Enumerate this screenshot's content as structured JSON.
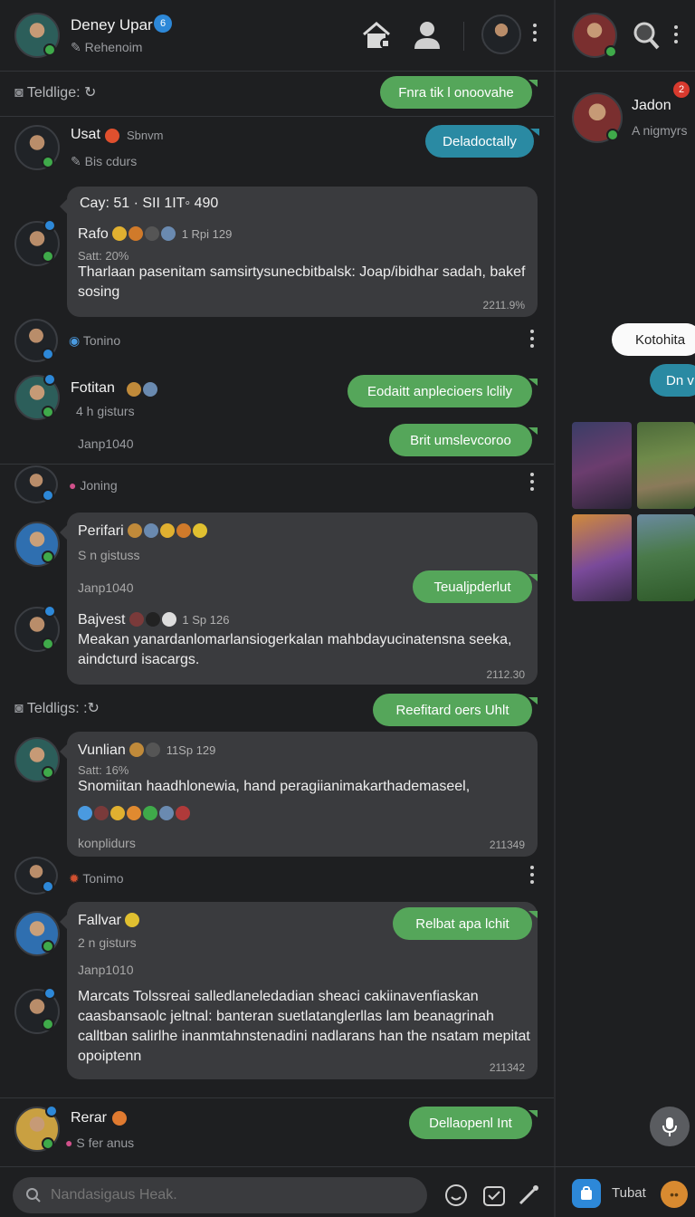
{
  "header": {
    "user_name": "Deney Upar",
    "user_sub": "Rehenoim",
    "badge_count": "6"
  },
  "right_panel": {
    "contact_name": "Jadon",
    "contact_sub": "A nigmyrs",
    "contact_badge": "2",
    "bubble_white": "Kotohita",
    "bubble_teal": "Dn v",
    "bottom_label": "Tubat"
  },
  "rows": {
    "section1_label": "Teldlige:",
    "section1_pill": "Fnra tik l onoovahe",
    "usat_name": "Usat",
    "usat_extra": "Sbnvm",
    "usat_sub": "Bis cdurs",
    "usat_pill": "Deladoctally",
    "card1_header": "Cay:  51 · SII 1IT◦ 490",
    "card1_name": "Rafo",
    "card1_meta": "1 Rpi 129",
    "card1_sub": "Satt: 20%",
    "card1_text": "Tharlaan pasenitam samsirtysunecbitbalsk: Joap/ibidhar sadah, bakef sosing",
    "card1_time": "2211.9%",
    "tonino1": "Tonino",
    "fotitan_name": "Fotitan",
    "fotitan_sub": "4 h gisturs",
    "fotitan_pill": "Eodaitt anplecioers lclily",
    "fotitan_date": "Janp1040",
    "fotitan_pill2": "Brit umslevcoroo",
    "joning": "Joning",
    "card2_name": "Perifari",
    "card2_sub": "S n gistuss",
    "card2_date": "Janp1040",
    "card2_pill": "Teualjpderlut",
    "card2_name2": "Bajvest",
    "card2_meta": "1 Sp 126",
    "card2_text": "Meakan yanardanlomarlansiogerkalan mahbdayucinatensna seeka, aindcturd isacargs.",
    "card2_time": "2112.30",
    "section2_label": "Teldligs:",
    "section2_pill": "Reefitard oers Uhlt",
    "card3_name": "Vunlian",
    "card3_meta": "11Sp 129",
    "card3_sub": "Satt: 16%",
    "card3_text": "Snomiitan haadhlonewia, hand peragiianimakarthademaseel,",
    "card3_foot": "konplidurs",
    "card3_time": "211349",
    "tonino2": "Tonimo",
    "card4_name": "Fallvar",
    "card4_sub": "2 n gisturs",
    "card4_pill": "Relbat  apa lchit",
    "card4_date": "Janp1010",
    "card4_text": "Marcats  Tolssreai salledlaneledadian sheaci cakiinavenfiaskan caasbansaolc jeltnal: banteran suetlatanglerllas lam  beanagrinah calltban salirlhe inanmtahnstenadini nadlarans han the nsatam mepitat opoiptenn",
    "card4_time": "211342",
    "rerar_name": "Rerar",
    "rerar_sub": "S fer anus",
    "rerar_pill": "Dellaopenl Int"
  },
  "footer": {
    "search_placeholder": "Nandasigaus Heak."
  },
  "colors": {
    "background": "#1e1f21",
    "pill_green": "#55a65a",
    "pill_teal": "#2a8aa3",
    "card": "#3a3b3e"
  }
}
